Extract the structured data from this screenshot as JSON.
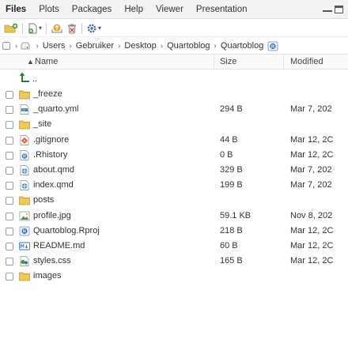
{
  "tabs": [
    "Files",
    "Plots",
    "Packages",
    "Help",
    "Viewer",
    "Presentation"
  ],
  "active_tab": 0,
  "breadcrumb": [
    "Users",
    "Gebruiker",
    "Desktop",
    "Quartoblog",
    "Quartoblog"
  ],
  "columns": {
    "name": "Name",
    "size": "Size",
    "modified": "Modified"
  },
  "sort_indicator": "▲",
  "files": [
    {
      "name": "_freeze",
      "size": "",
      "modified": "",
      "icon": "folder-icon"
    },
    {
      "name": "_quarto.yml",
      "size": "294 B",
      "modified": "Mar 7, 202",
      "icon": "yaml-file-icon"
    },
    {
      "name": "_site",
      "size": "",
      "modified": "",
      "icon": "folder-icon"
    },
    {
      "name": ".gitignore",
      "size": "44 B",
      "modified": "Mar 12, 2C",
      "icon": "git-file-icon"
    },
    {
      "name": ".Rhistory",
      "size": "0 B",
      "modified": "Mar 12, 2C",
      "icon": "r-history-file-icon"
    },
    {
      "name": "about.qmd",
      "size": "329 B",
      "modified": "Mar 7, 202",
      "icon": "qmd-file-icon"
    },
    {
      "name": "index.qmd",
      "size": "199 B",
      "modified": "Mar 7, 202",
      "icon": "qmd-file-icon"
    },
    {
      "name": "posts",
      "size": "",
      "modified": "",
      "icon": "folder-icon"
    },
    {
      "name": "profile.jpg",
      "size": "59.1 KB",
      "modified": "Nov 8, 202",
      "icon": "image-file-icon"
    },
    {
      "name": "Quartoblog.Rproj",
      "size": "218 B",
      "modified": "Mar 12, 2C",
      "icon": "rproj-file-icon"
    },
    {
      "name": "README.md",
      "size": "60 B",
      "modified": "Mar 12, 2C",
      "icon": "markdown-file-icon"
    },
    {
      "name": "styles.css",
      "size": "165 B",
      "modified": "Mar 12, 2C",
      "icon": "css-file-icon"
    },
    {
      "name": "images",
      "size": "",
      "modified": "",
      "icon": "folder-icon"
    }
  ]
}
